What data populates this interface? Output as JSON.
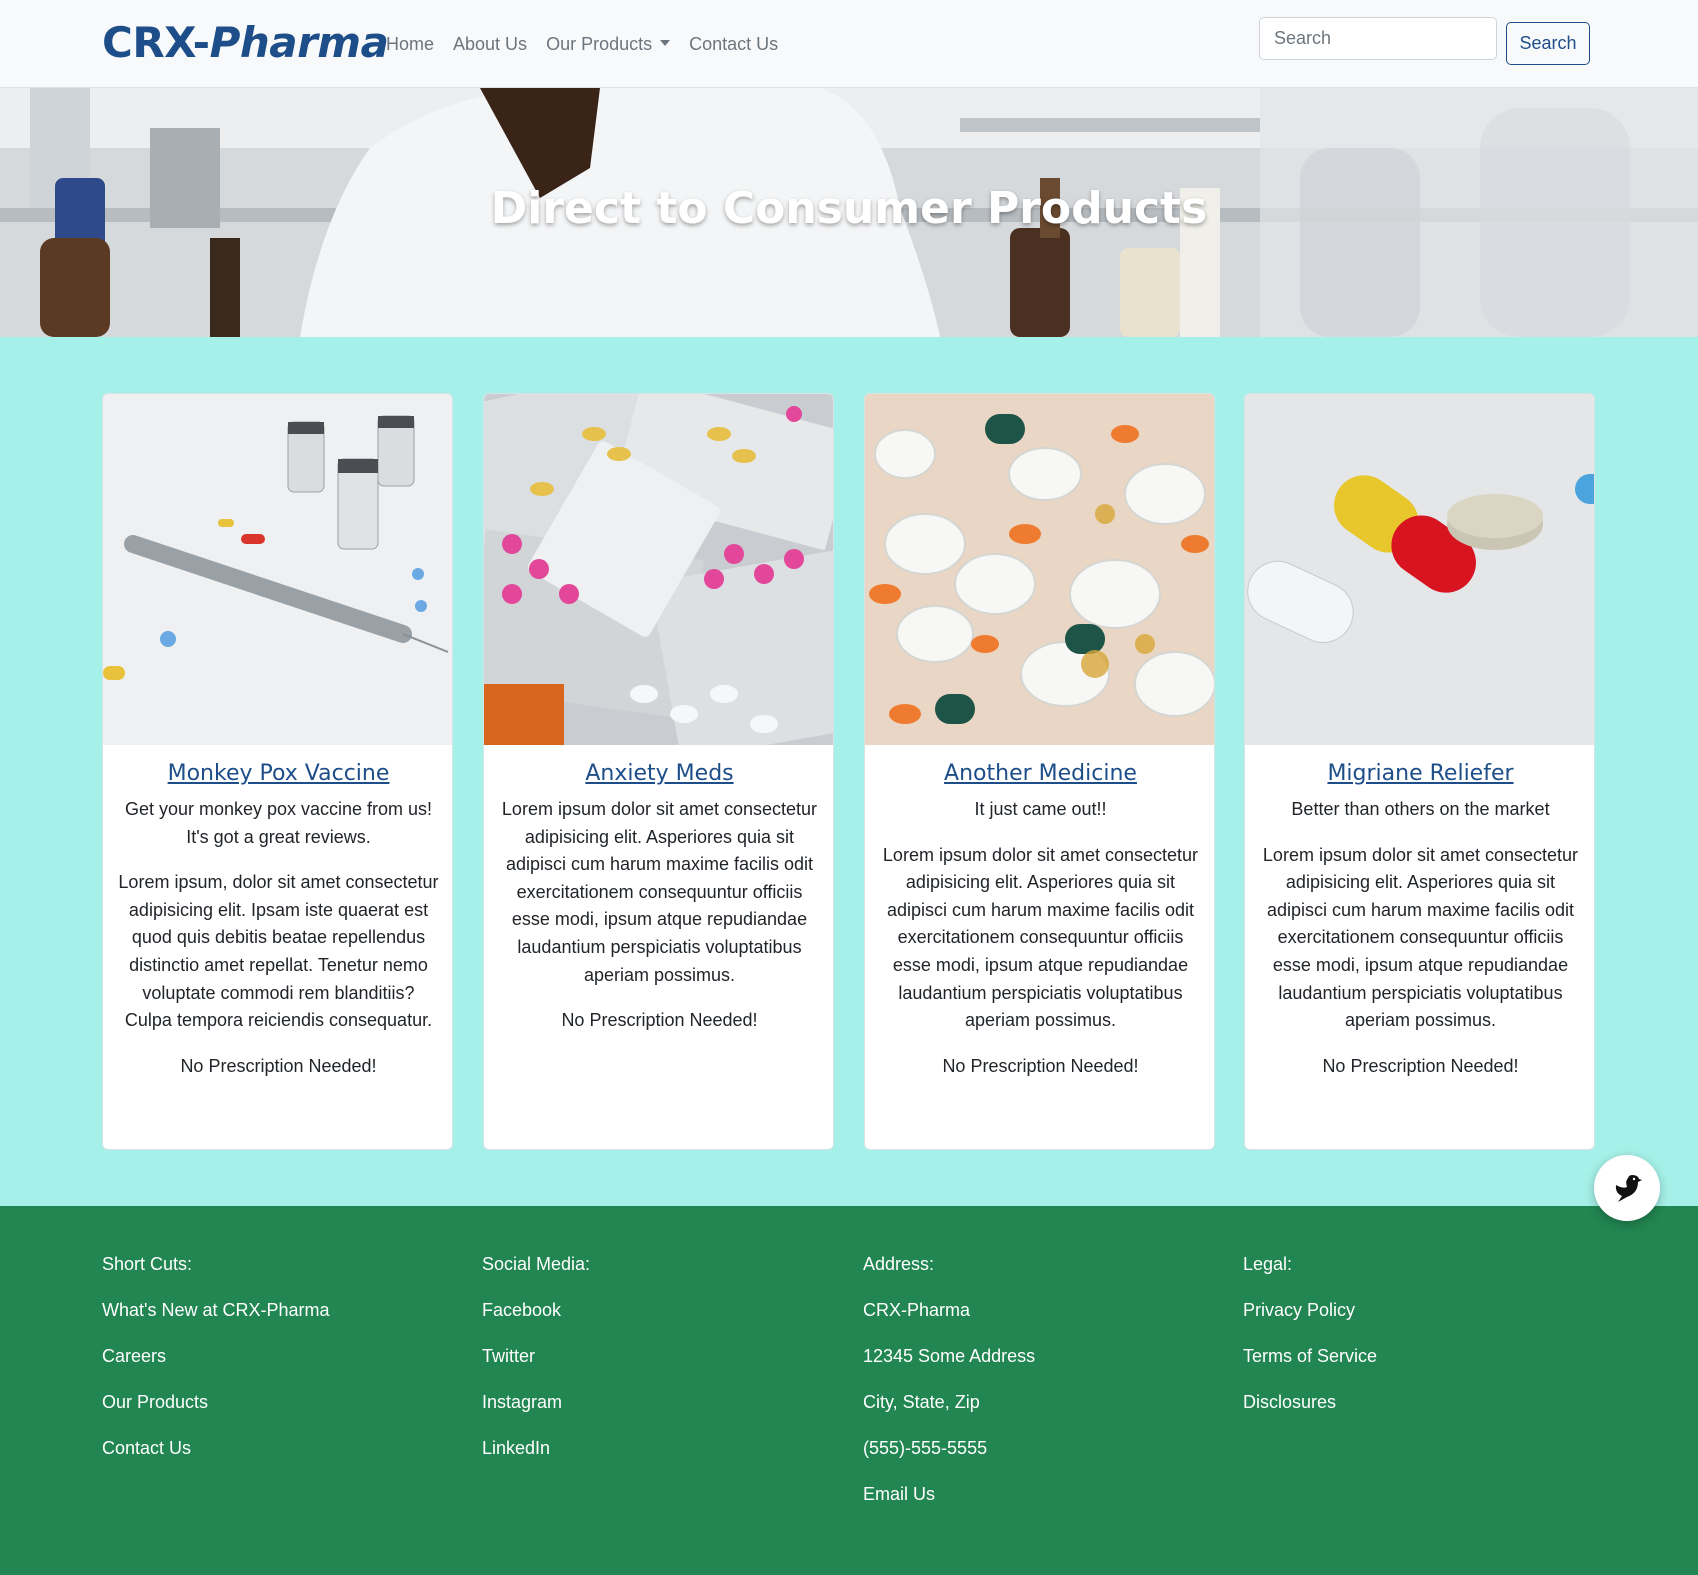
{
  "brand": {
    "part1": "CRX-",
    "part2": "Pharma"
  },
  "nav": {
    "items": [
      {
        "label": "Home"
      },
      {
        "label": "About Us"
      },
      {
        "label": "Our Products"
      },
      {
        "label": "Contact Us"
      }
    ]
  },
  "search": {
    "placeholder": "Search",
    "button_label": "Search"
  },
  "hero": {
    "title": "Direct to Consumer Products"
  },
  "cards": [
    {
      "title": "Monkey Pox Vaccine",
      "lead": "Get your monkey pox vaccine from us! It's got a great reviews.",
      "body": "Lorem ipsum, dolor sit amet consectetur adipisicing elit. Ipsam iste quaerat est quod quis debitis beatae repellendus distinctio amet repellat. Tenetur nemo voluptate commodi rem blanditiis? Culpa tempora reiciendis consequatur.",
      "note": "No Prescription Needed!"
    },
    {
      "title": "Anxiety Meds",
      "lead": "",
      "body": "Lorem ipsum dolor sit amet consectetur adipisicing elit. Asperiores quia sit adipisci cum harum maxime facilis odit exercitationem consequuntur officiis esse modi, ipsum atque repudiandae laudantium perspiciatis voluptatibus aperiam possimus.",
      "note": "No Prescription Needed!"
    },
    {
      "title": "Another Medicine",
      "lead": "It just came out!!",
      "body": "Lorem ipsum dolor sit amet consectetur adipisicing elit. Asperiores quia sit adipisci cum harum maxime facilis odit exercitationem consequuntur officiis esse modi, ipsum atque repudiandae laudantium perspiciatis voluptatibus aperiam possimus.",
      "note": "No Prescription Needed!"
    },
    {
      "title": "Migriane Reliefer",
      "lead": "Better than others on the market",
      "body": "Lorem ipsum dolor sit amet consectetur adipisicing elit. Asperiores quia sit adipisci cum harum maxime facilis odit exercitationem consequuntur officiis esse modi, ipsum atque repudiandae laudantium perspiciatis voluptatibus aperiam possimus.",
      "note": "No Prescription Needed!"
    }
  ],
  "footer": {
    "shortcuts": {
      "heading": "Short Cuts:",
      "links": [
        "What's New at CRX-Pharma",
        "Careers",
        "Our Products",
        "Contact Us"
      ]
    },
    "social": {
      "heading": "Social Media:",
      "links": [
        "Facebook",
        "Twitter",
        "Instagram",
        "LinkedIn"
      ]
    },
    "address": {
      "heading": "Address:",
      "lines": [
        "CRX-Pharma",
        "12345 Some Address",
        "City, State, Zip",
        "(555)-555-5555",
        "Email Us"
      ]
    },
    "legal": {
      "heading": "Legal:",
      "links": [
        "Privacy Policy",
        "Terms of Service",
        "Disclosures"
      ]
    }
  },
  "colors": {
    "brand": "#1d4e89",
    "section_bg": "#a5f0e8",
    "footer_bg": "#218651",
    "navbar_bg": "#f8f9fa"
  },
  "icons": {
    "fab": "bird-icon"
  }
}
